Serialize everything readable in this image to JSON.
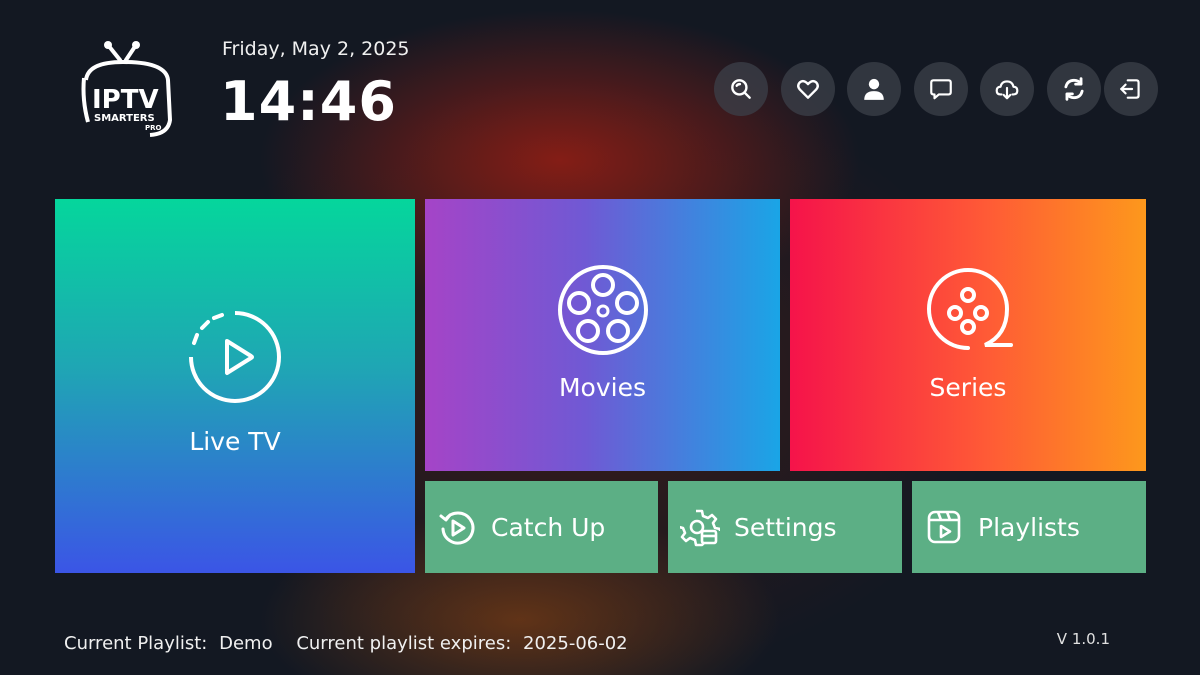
{
  "logo": {
    "main": "IPTV",
    "sub": "SMARTERS",
    "tag": "PRO"
  },
  "header": {
    "date": "Friday, May 2, 2025",
    "time": "14:46"
  },
  "toolbar": [
    "search-icon",
    "heart-icon",
    "user-icon",
    "chat-icon",
    "cloud-download-icon",
    "refresh-icon",
    "logout-icon"
  ],
  "tiles": {
    "live_tv": "Live TV",
    "movies": "Movies",
    "series": "Series",
    "catch_up": "Catch Up",
    "settings": "Settings",
    "playlists": "Playlists"
  },
  "footer": {
    "playlist_label": "Current Playlist:",
    "playlist_value": "Demo",
    "expires_label": "Current playlist expires:",
    "expires_value": "2025-06-02",
    "version": "V 1.0.1"
  },
  "colors": {
    "live_tv": [
      "#05d69c",
      "#3b55e6"
    ],
    "movies": [
      "#a544c7",
      "#1aa5e6"
    ],
    "series": [
      "#f5134a",
      "#fd981c"
    ],
    "small_tiles": "#5caf85",
    "background": "#131822"
  }
}
